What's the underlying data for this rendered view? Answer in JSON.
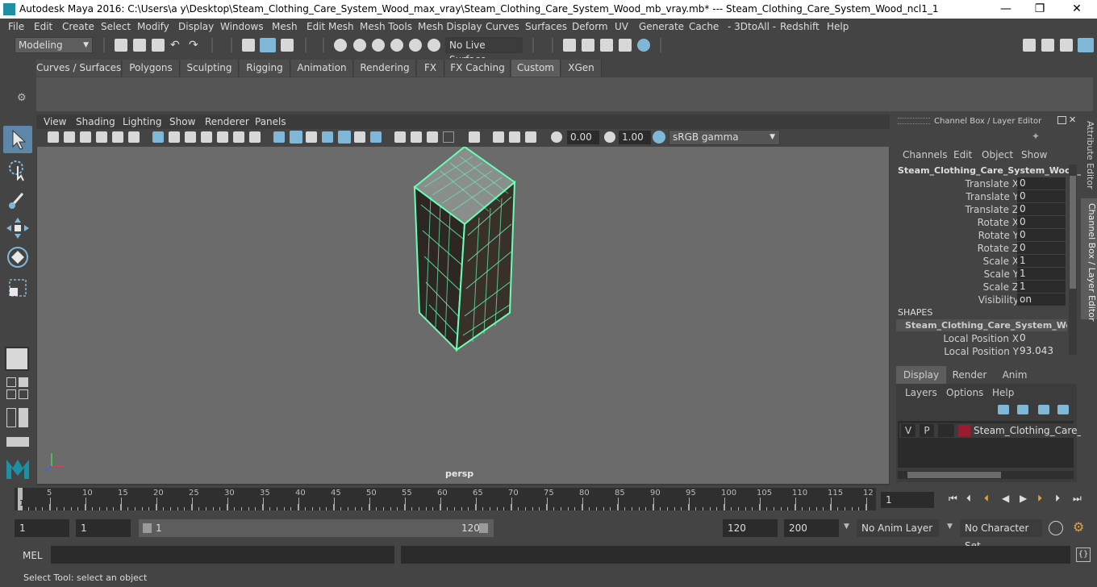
{
  "window": {
    "title": "Autodesk Maya 2016: C:\\Users\\a y\\Desktop\\Steam_Clothing_Care_System_Wood_max_vray\\Steam_Clothing_Care_System_Wood_mb_vray.mb*   ---   Steam_Clothing_Care_System_Wood_ncl1_1",
    "minimize": "—",
    "maximize": "❐",
    "close": "✕"
  },
  "menubar": [
    "File",
    "Edit",
    "Create",
    "Select",
    "Modify",
    "Display",
    "Windows",
    "Mesh",
    "Edit Mesh",
    "Mesh Tools",
    "Mesh Display",
    "Curves",
    "Surfaces",
    "Deform",
    "UV",
    "Generate",
    "Cache",
    "- 3DtoAll -",
    "Redshift",
    "Help"
  ],
  "status": {
    "mode": "Modeling",
    "live_surface": "No Live Surface"
  },
  "shelf": {
    "tabs": [
      "Curves / Surfaces",
      "Polygons",
      "Sculpting",
      "Rigging",
      "Animation",
      "Rendering",
      "FX",
      "FX Caching",
      "Custom",
      "XGen"
    ],
    "active_tab": "Custom"
  },
  "viewport": {
    "menu": [
      "View",
      "Shading",
      "Lighting",
      "Show",
      "Renderer",
      "Panels"
    ],
    "exposure": "0.00",
    "gamma": "1.00",
    "color_space": "sRGB gamma",
    "camera_label": "persp"
  },
  "channel_box": {
    "title": "Channel Box / Layer Editor",
    "menu": [
      "Channels",
      "Edit",
      "Object",
      "Show"
    ],
    "object_name": "Steam_Clothing_Care_System_Wood_...",
    "channels": [
      {
        "label": "Translate X",
        "value": "0"
      },
      {
        "label": "Translate Y",
        "value": "0"
      },
      {
        "label": "Translate Z",
        "value": "0"
      },
      {
        "label": "Rotate X",
        "value": "0"
      },
      {
        "label": "Rotate Y",
        "value": "0"
      },
      {
        "label": "Rotate Z",
        "value": "0"
      },
      {
        "label": "Scale X",
        "value": "1"
      },
      {
        "label": "Scale Y",
        "value": "1"
      },
      {
        "label": "Scale Z",
        "value": "1"
      },
      {
        "label": "Visibility",
        "value": "on"
      }
    ],
    "shapes_header": "SHAPES",
    "shape_name": "Steam_Clothing_Care_System_Wood...",
    "shape_channels": [
      {
        "label": "Local Position X",
        "value": "0"
      },
      {
        "label": "Local Position Y",
        "value": "93.043"
      }
    ],
    "layer_tabs": [
      "Display",
      "Render",
      "Anim"
    ],
    "layer_menu": [
      "Layers",
      "Options",
      "Help"
    ],
    "layer": {
      "v": "V",
      "p": "P",
      "name": "Steam_Clothing_Care_Sy",
      "color": "#9b1b30"
    },
    "side_tabs": [
      "Attribute Editor",
      "Channel Box / Layer Editor"
    ]
  },
  "timeline": {
    "ticks": [
      "5",
      "10",
      "15",
      "20",
      "25",
      "30",
      "35",
      "40",
      "45",
      "50",
      "55",
      "60",
      "65",
      "70",
      "75",
      "80",
      "85",
      "90",
      "95",
      "100",
      "105",
      "110",
      "115",
      "12"
    ],
    "current_frame_marker": "1",
    "current_frame": "1"
  },
  "range": {
    "start": "1",
    "anim_start": "1",
    "slider_start": "1",
    "slider_end": "120",
    "range_end": "120",
    "anim_end": "200",
    "anim_layer": "No Anim Layer",
    "character_set": "No Character Set"
  },
  "command": {
    "label": "MEL"
  },
  "help_line": "Select Tool: select an object",
  "colors": {
    "wireframe": "#66ffb3",
    "active_tool": "#5e86a8",
    "viewport_bg": "#6b6b6b"
  }
}
